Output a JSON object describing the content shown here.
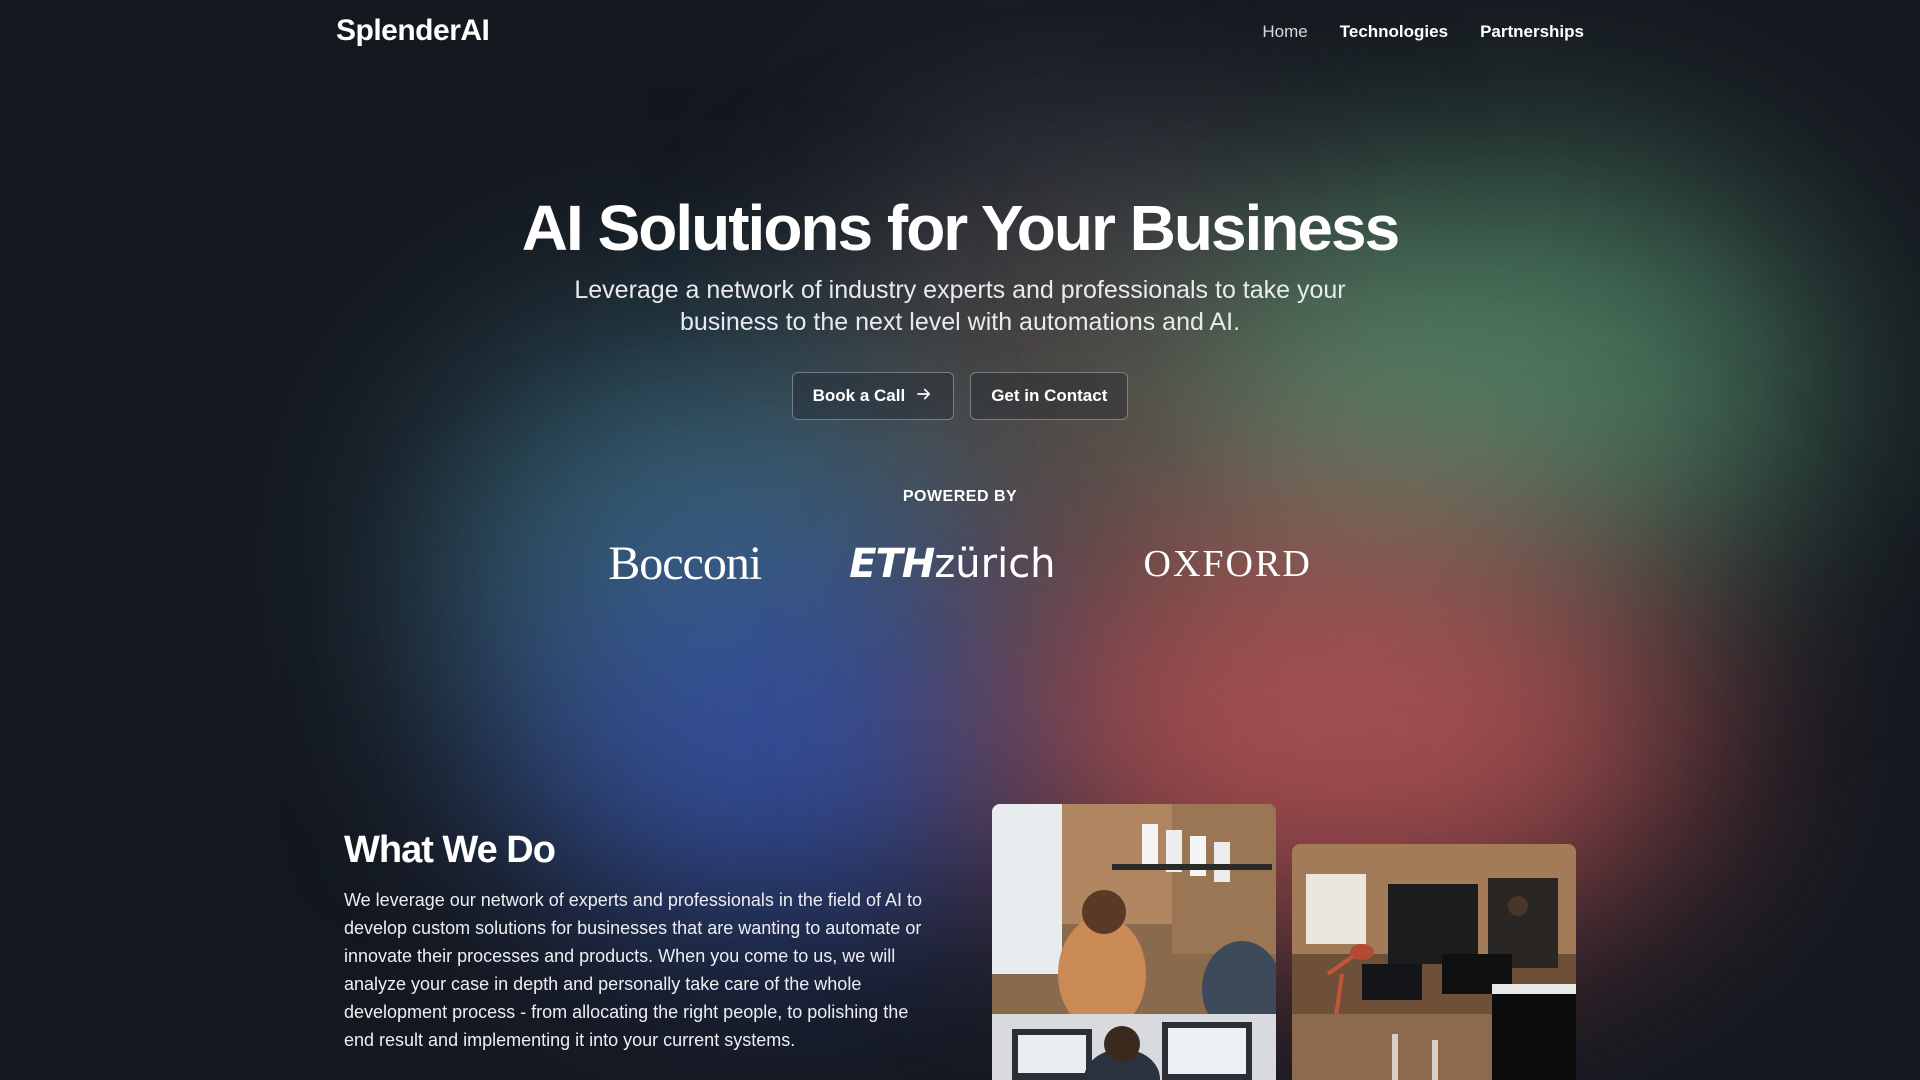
{
  "header": {
    "logo": "SplenderAI",
    "nav": [
      {
        "label": "Home"
      },
      {
        "label": "Technologies"
      },
      {
        "label": "Partnerships"
      }
    ]
  },
  "hero": {
    "title": "AI Solutions for Your Business",
    "subtitle": "Leverage a network of industry experts and professionals to take your business to the next level with automations and AI.",
    "buttons": {
      "book_call": "Book a Call",
      "get_in_contact": "Get in Contact"
    }
  },
  "powered_by": {
    "label": "POWERED BY",
    "partners": {
      "bocconi": "Bocconi",
      "eth_strong": "ETH",
      "eth_light": "zürich",
      "oxford": "OXFORD"
    }
  },
  "what_we_do": {
    "title": "What We Do",
    "body": "We leverage our network of experts and professionals in the field of AI to develop custom solutions for businesses that are wanting to automate or innovate their processes and products. When you come to us, we will analyze your case in depth and personally take care of the whole development process - from allocating the right people, to polishing the end result and implementing it into your current systems."
  },
  "icons": {
    "cta_arrow": "arrow-right-icon"
  },
  "colors": {
    "background": "#14181f",
    "text": "#ffffff"
  }
}
